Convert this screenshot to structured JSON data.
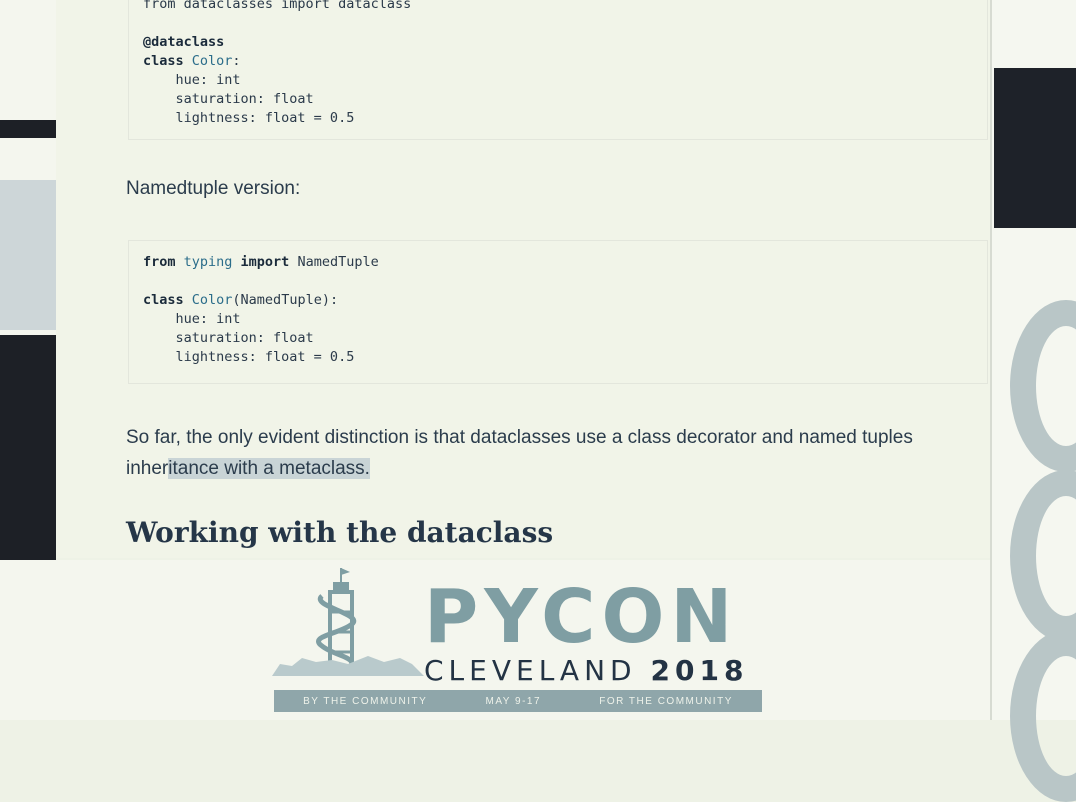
{
  "code_block_1": {
    "lines": [
      [
        {
          "t": "from dataclasses import dataclass",
          "c": "plain"
        }
      ],
      [
        {
          "t": "",
          "c": "plain"
        }
      ],
      [
        {
          "t": "@dataclass",
          "c": "kw"
        }
      ],
      [
        {
          "t": "class ",
          "c": "kw"
        },
        {
          "t": "Color",
          "c": "cls"
        },
        {
          "t": ":",
          "c": "plain"
        }
      ],
      [
        {
          "t": "    hue: int",
          "c": "plain"
        }
      ],
      [
        {
          "t": "    saturation: float",
          "c": "plain"
        }
      ],
      [
        {
          "t": "    lightness: float = 0.5",
          "c": "plain"
        }
      ]
    ]
  },
  "namedtuple_label": "Namedtuple version:",
  "code_block_2": {
    "lines": [
      [
        {
          "t": "from ",
          "c": "kw"
        },
        {
          "t": "typing ",
          "c": "cls"
        },
        {
          "t": "import ",
          "c": "kw"
        },
        {
          "t": "NamedTuple",
          "c": "plain"
        }
      ],
      [
        {
          "t": "",
          "c": "plain"
        }
      ],
      [
        {
          "t": "class ",
          "c": "kw"
        },
        {
          "t": "Color",
          "c": "cls"
        },
        {
          "t": "(NamedTuple):",
          "c": "plain"
        }
      ],
      [
        {
          "t": "    hue: int",
          "c": "plain"
        }
      ],
      [
        {
          "t": "    saturation: float",
          "c": "plain"
        }
      ],
      [
        {
          "t": "    lightness: float = 0.5",
          "c": "plain"
        }
      ]
    ]
  },
  "paragraph": {
    "line1": "So far, the only evident distinction is that dataclasses use a class decorator and named tuples",
    "line2_plain": "inher",
    "line2_highlight": "itance with a metaclass."
  },
  "heading": "Working with the dataclass",
  "banner": {
    "pycon": "PYCON",
    "city": "CLEVELAND ",
    "year": "2018",
    "ribbon": [
      "BY THE COMMUNITY",
      "MAY 9-17",
      "FOR THE COMMUNITY"
    ]
  },
  "colors": {
    "accent": "#7f9ea3",
    "text": "#2b3c4c",
    "dark": "#1d2026"
  }
}
